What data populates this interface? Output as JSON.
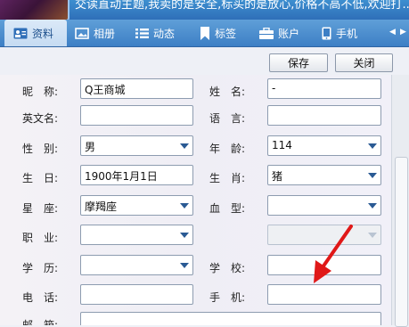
{
  "banner": {
    "text": "交读直动主题,我卖的是安全,标买的是放心,价格不高不低,欢迎打..."
  },
  "tabs": [
    {
      "label": "资料",
      "icon": "profile-card-icon"
    },
    {
      "label": "相册",
      "icon": "photo-album-icon"
    },
    {
      "label": "动态",
      "icon": "feed-list-icon"
    },
    {
      "label": "标签",
      "icon": "bookmark-icon"
    },
    {
      "label": "账户",
      "icon": "briefcase-icon"
    },
    {
      "label": "手机",
      "icon": "mobile-phone-icon"
    }
  ],
  "toolbar": {
    "save_label": "保存",
    "close_label": "关闭"
  },
  "form": {
    "nickname": {
      "label": "昵　称:",
      "value": "Q王商城"
    },
    "name": {
      "label": "姓　名:",
      "value": "-"
    },
    "english_name": {
      "label": "英文名:",
      "value": ""
    },
    "language": {
      "label": "语　言:",
      "value": ""
    },
    "gender": {
      "label": "性　别:",
      "value": "男"
    },
    "age": {
      "label": "年　龄:",
      "value": "114"
    },
    "birthday": {
      "label": "生　日:",
      "value": "1900年1月1日"
    },
    "zodiac": {
      "label": "生　肖:",
      "value": "猪"
    },
    "constellation": {
      "label": "星　座:",
      "value": "摩羯座"
    },
    "blood_type": {
      "label": "血　型:",
      "value": ""
    },
    "occupation": {
      "label": "职　业:",
      "value": ""
    },
    "education": {
      "label": "学　历:",
      "value": ""
    },
    "school": {
      "label": "学　校:",
      "value": ""
    },
    "phone": {
      "label": "电　话:",
      "value": ""
    },
    "mobile": {
      "label": "手　机:",
      "value": ""
    },
    "email": {
      "label": "邮　箱:",
      "value": ""
    }
  },
  "colors": {
    "accent": "#3d7fc5",
    "annotation_arrow": "#e01818"
  }
}
